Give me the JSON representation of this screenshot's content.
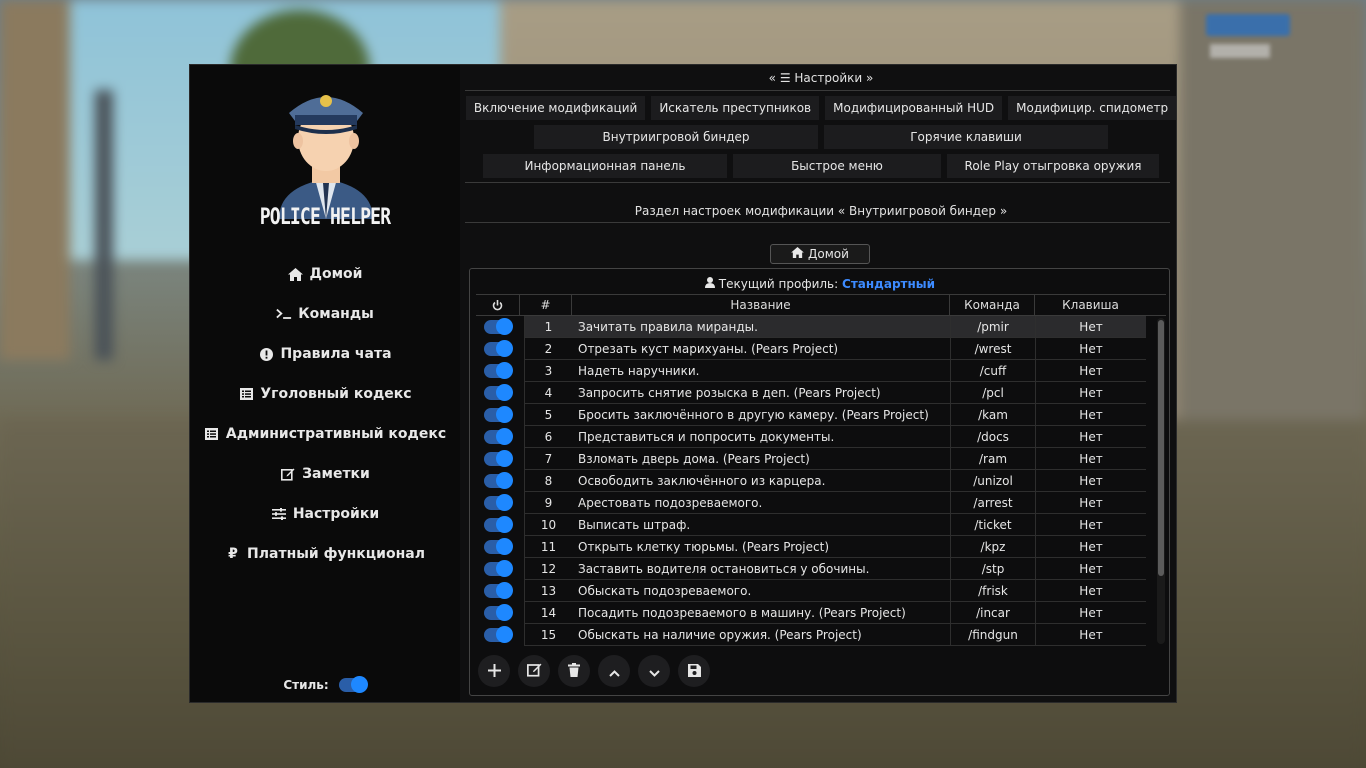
{
  "app": {
    "logo_text": "POLICE HELPER"
  },
  "sidebar": {
    "items": [
      {
        "label": "Домой",
        "icon": "home-icon"
      },
      {
        "label": "Команды",
        "icon": "terminal-icon"
      },
      {
        "label": "Правила чата",
        "icon": "exclamation-circle-icon"
      },
      {
        "label": "Уголовный кодекс",
        "icon": "list-icon"
      },
      {
        "label": "Административный кодекс",
        "icon": "list-icon"
      },
      {
        "label": "Заметки",
        "icon": "edit-icon"
      },
      {
        "label": "Настройки",
        "icon": "sliders-icon"
      },
      {
        "label": "Платный функционал",
        "icon": "ruble-icon"
      }
    ],
    "style_label": "Стиль:",
    "style_toggle_on": true
  },
  "settings": {
    "title": "« ☰ Настройки »",
    "tabs_row1": [
      "Включение модификаций",
      "Искатель преступников",
      "Модифицированный HUD",
      "Модифицир. спидометр"
    ],
    "tabs_row2": [
      "Внутриигровой биндер",
      "Горячие клавиши"
    ],
    "tabs_row3": [
      "Информационная панель",
      "Быстрое меню",
      "Role Play отыгровка оружия"
    ],
    "section_title": "Раздел настроек модификации « Внутриигровой биндер »",
    "home_button": "Домой"
  },
  "panel": {
    "profile_label": "Текущий профиль:",
    "profile_value": "Стандартный",
    "columns": [
      "",
      "#",
      "Название",
      "Команда",
      "Клавиша"
    ],
    "rows": [
      {
        "n": "1",
        "name": "Зачитать правила миранды.",
        "cmd": "/pmir",
        "key": "Нет",
        "on": true,
        "selected": true
      },
      {
        "n": "2",
        "name": "Отрезать куст марихуаны. (Pears Project)",
        "cmd": "/wrest",
        "key": "Нет",
        "on": true
      },
      {
        "n": "3",
        "name": "Надеть наручники.",
        "cmd": "/cuff",
        "key": "Нет",
        "on": true
      },
      {
        "n": "4",
        "name": "Запросить снятие розыска в деп. (Pears Project)",
        "cmd": "/pcl",
        "key": "Нет",
        "on": true
      },
      {
        "n": "5",
        "name": "Бросить заключённого в другую камеру. (Pears Project)",
        "cmd": "/kam",
        "key": "Нет",
        "on": true
      },
      {
        "n": "6",
        "name": "Представиться и попросить документы.",
        "cmd": "/docs",
        "key": "Нет",
        "on": true
      },
      {
        "n": "7",
        "name": "Взломать дверь дома. (Pears Project)",
        "cmd": "/ram",
        "key": "Нет",
        "on": true
      },
      {
        "n": "8",
        "name": "Освободить заключённого из карцера.",
        "cmd": "/unizol",
        "key": "Нет",
        "on": true
      },
      {
        "n": "9",
        "name": "Арестовать подозреваемого.",
        "cmd": "/arrest",
        "key": "Нет",
        "on": true
      },
      {
        "n": "10",
        "name": "Выписать штраф.",
        "cmd": "/ticket",
        "key": "Нет",
        "on": true
      },
      {
        "n": "11",
        "name": "Открыть клетку тюрьмы. (Pears Project)",
        "cmd": "/kpz",
        "key": "Нет",
        "on": true
      },
      {
        "n": "12",
        "name": "Заставить водителя остановиться у обочины.",
        "cmd": "/stp",
        "key": "Нет",
        "on": true
      },
      {
        "n": "13",
        "name": "Обыскать подозреваемого.",
        "cmd": "/frisk",
        "key": "Нет",
        "on": true
      },
      {
        "n": "14",
        "name": "Посадить подозреваемого в машину. (Pears Project)",
        "cmd": "/incar",
        "key": "Нет",
        "on": true
      },
      {
        "n": "15",
        "name": "Обыскать на наличие оружия. (Pears Project)",
        "cmd": "/findgun",
        "key": "Нет",
        "on": true
      }
    ],
    "toolbar": [
      "plus-icon",
      "edit-icon",
      "trash-icon",
      "chevron-up-icon",
      "chevron-down-icon",
      "save-icon"
    ]
  },
  "colors": {
    "accent": "#1e88ff",
    "profile_value": "#3d8bff",
    "window_bg": "#0f0f10"
  }
}
